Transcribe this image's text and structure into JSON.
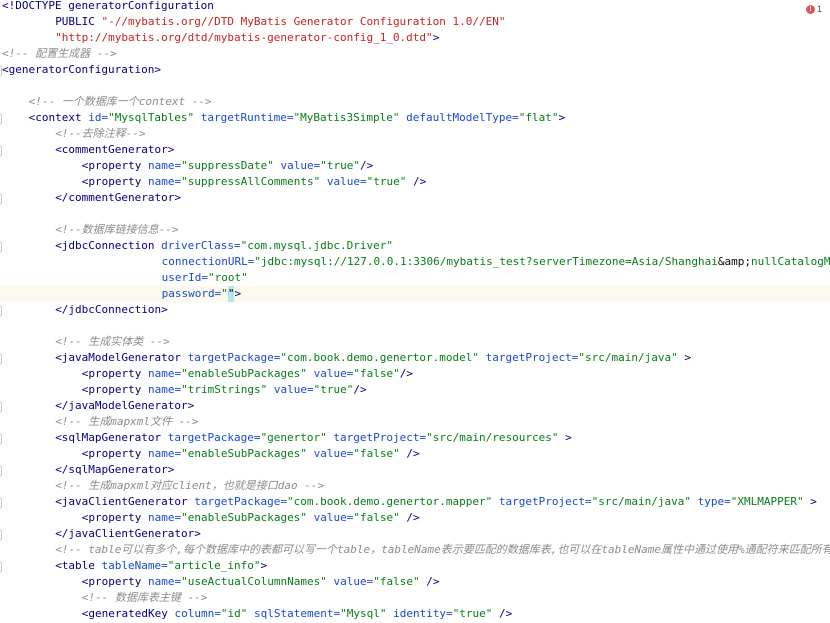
{
  "status": {
    "problems_count": "1",
    "problems_icon": "error-icon"
  },
  "current_line": 18,
  "lines": [
    {
      "indent": 0,
      "mark": false,
      "tokens": [
        [
          "dtd",
          "<!DOCTYPE generatorConfiguration"
        ]
      ]
    },
    {
      "indent": 4,
      "mark": false,
      "tokens": [
        [
          "dtd",
          "PUBLIC "
        ],
        [
          "str",
          "\"-//mybatis.org//DTD MyBatis Generator Configuration 1.0//EN\""
        ]
      ]
    },
    {
      "indent": 4,
      "mark": false,
      "tokens": [
        [
          "str",
          "\"http://mybatis.org/dtd/mybatis-generator-config_1_0.dtd\""
        ],
        [
          "dtd",
          ">"
        ]
      ]
    },
    {
      "indent": 0,
      "mark": false,
      "tokens": [
        [
          "cmt",
          "<!-- 配置生成器 -->"
        ]
      ]
    },
    {
      "indent": 0,
      "mark": true,
      "tokens": [
        [
          "tag",
          "<generatorConfiguration>"
        ]
      ]
    },
    {
      "indent": 0,
      "mark": false,
      "tokens": []
    },
    {
      "indent": 2,
      "mark": false,
      "tokens": [
        [
          "cmt",
          "<!-- 一个数据库一个context -->"
        ]
      ]
    },
    {
      "indent": 2,
      "mark": true,
      "tokens": [
        [
          "tag",
          "<context "
        ],
        [
          "attr",
          "id="
        ],
        [
          "val",
          "\"MysqlTables\" "
        ],
        [
          "attr",
          "targetRuntime="
        ],
        [
          "val",
          "\"MyBatis3Simple\" "
        ],
        [
          "attr",
          "defaultModelType="
        ],
        [
          "val",
          "\"flat\""
        ],
        [
          "tag",
          ">"
        ]
      ]
    },
    {
      "indent": 4,
      "mark": false,
      "tokens": [
        [
          "cmt",
          "<!--去除注释-->"
        ]
      ]
    },
    {
      "indent": 4,
      "mark": true,
      "tokens": [
        [
          "tag",
          "<commentGenerator>"
        ]
      ]
    },
    {
      "indent": 6,
      "mark": false,
      "tokens": [
        [
          "tag",
          "<property "
        ],
        [
          "attr",
          "name="
        ],
        [
          "val",
          "\"suppressDate\" "
        ],
        [
          "attr",
          "value="
        ],
        [
          "val",
          "\"true\""
        ],
        [
          "tag",
          "/>"
        ]
      ]
    },
    {
      "indent": 6,
      "mark": false,
      "tokens": [
        [
          "tag",
          "<property "
        ],
        [
          "attr",
          "name="
        ],
        [
          "val",
          "\"suppressAllComments\" "
        ],
        [
          "attr",
          "value="
        ],
        [
          "val",
          "\"true\" "
        ],
        [
          "tag",
          "/>"
        ]
      ]
    },
    {
      "indent": 4,
      "mark": true,
      "tokens": [
        [
          "tag",
          "</commentGenerator>"
        ]
      ]
    },
    {
      "indent": 0,
      "mark": false,
      "tokens": []
    },
    {
      "indent": 4,
      "mark": false,
      "tokens": [
        [
          "cmt",
          "<!--数据库链接信息-->"
        ]
      ]
    },
    {
      "indent": 4,
      "mark": true,
      "tokens": [
        [
          "tag",
          "<jdbcConnection "
        ],
        [
          "attr",
          "driverClass="
        ],
        [
          "val",
          "\"com.mysql.jdbc.Driver\""
        ]
      ]
    },
    {
      "indent": 12,
      "mark": false,
      "tokens": [
        [
          "attr",
          "connectionURL="
        ],
        [
          "val",
          "\"jdbc:mysql://127.0.0.1:3306/mybatis_test?serverTimezone=Asia/Shanghai"
        ],
        [
          "plain",
          "&amp;"
        ],
        [
          "val",
          "nullCatalogMeansCurrent=true\""
        ]
      ]
    },
    {
      "indent": 12,
      "mark": false,
      "tokens": [
        [
          "attr",
          "userId="
        ],
        [
          "val",
          "\"root\""
        ]
      ]
    },
    {
      "indent": 12,
      "mark": false,
      "tokens": [
        [
          "attr",
          "password="
        ],
        [
          "val",
          "\""
        ],
        [
          "caret",
          "\""
        ],
        [
          "tag",
          ">"
        ]
      ]
    },
    {
      "indent": 4,
      "mark": true,
      "tokens": [
        [
          "tag",
          "</jdbcConnection>"
        ]
      ]
    },
    {
      "indent": 0,
      "mark": false,
      "tokens": []
    },
    {
      "indent": 4,
      "mark": false,
      "tokens": [
        [
          "cmt",
          "<!-- 生成实体类 -->"
        ]
      ]
    },
    {
      "indent": 4,
      "mark": true,
      "tokens": [
        [
          "tag",
          "<javaModelGenerator "
        ],
        [
          "attr",
          "targetPackage="
        ],
        [
          "val",
          "\"com.book.demo.genertor.model\" "
        ],
        [
          "attr",
          "targetProject="
        ],
        [
          "val",
          "\"src/main/java\" "
        ],
        [
          "tag",
          ">"
        ]
      ]
    },
    {
      "indent": 6,
      "mark": false,
      "tokens": [
        [
          "tag",
          "<property "
        ],
        [
          "attr",
          "name="
        ],
        [
          "val",
          "\"enableSubPackages\" "
        ],
        [
          "attr",
          "value="
        ],
        [
          "val",
          "\"false\""
        ],
        [
          "tag",
          "/>"
        ]
      ]
    },
    {
      "indent": 6,
      "mark": false,
      "tokens": [
        [
          "tag",
          "<property "
        ],
        [
          "attr",
          "name="
        ],
        [
          "val",
          "\"trimStrings\" "
        ],
        [
          "attr",
          "value="
        ],
        [
          "val",
          "\"true\""
        ],
        [
          "tag",
          "/>"
        ]
      ]
    },
    {
      "indent": 4,
      "mark": true,
      "tokens": [
        [
          "tag",
          "</javaModelGenerator>"
        ]
      ]
    },
    {
      "indent": 4,
      "mark": false,
      "tokens": [
        [
          "cmt",
          "<!-- 生成mapxml文件 -->"
        ]
      ]
    },
    {
      "indent": 4,
      "mark": true,
      "tokens": [
        [
          "tag",
          "<sqlMapGenerator "
        ],
        [
          "attr",
          "targetPackage="
        ],
        [
          "val",
          "\"genertor\" "
        ],
        [
          "attr",
          "targetProject="
        ],
        [
          "val",
          "\"src/main/resources\" "
        ],
        [
          "tag",
          ">"
        ]
      ]
    },
    {
      "indent": 6,
      "mark": false,
      "tokens": [
        [
          "tag",
          "<property "
        ],
        [
          "attr",
          "name="
        ],
        [
          "val",
          "\"enableSubPackages\" "
        ],
        [
          "attr",
          "value="
        ],
        [
          "val",
          "\"false\" "
        ],
        [
          "tag",
          "/>"
        ]
      ]
    },
    {
      "indent": 4,
      "mark": true,
      "tokens": [
        [
          "tag",
          "</sqlMapGenerator>"
        ]
      ]
    },
    {
      "indent": 4,
      "mark": false,
      "tokens": [
        [
          "cmt",
          "<!-- 生成mapxml对应client，也就是接口dao -->"
        ]
      ]
    },
    {
      "indent": 4,
      "mark": true,
      "tokens": [
        [
          "tag",
          "<javaClientGenerator "
        ],
        [
          "attr",
          "targetPackage="
        ],
        [
          "val",
          "\"com.book.demo.genertor.mapper\" "
        ],
        [
          "attr",
          "targetProject="
        ],
        [
          "val",
          "\"src/main/java\" "
        ],
        [
          "attr",
          "type="
        ],
        [
          "val",
          "\"XMLMAPPER\" "
        ],
        [
          "tag",
          ">"
        ]
      ]
    },
    {
      "indent": 6,
      "mark": false,
      "tokens": [
        [
          "tag",
          "<property "
        ],
        [
          "attr",
          "name="
        ],
        [
          "val",
          "\"enableSubPackages\" "
        ],
        [
          "attr",
          "value="
        ],
        [
          "val",
          "\"false\" "
        ],
        [
          "tag",
          "/>"
        ]
      ]
    },
    {
      "indent": 4,
      "mark": true,
      "tokens": [
        [
          "tag",
          "</javaClientGenerator>"
        ]
      ]
    },
    {
      "indent": 4,
      "mark": false,
      "tokens": [
        [
          "cmt",
          "<!-- table可以有多个,每个数据库中的表都可以写一个table，tableName表示要匹配的数据库表,也可以在tableName属性中通过使用%通配符来匹配所有数据库表,只有匹配的表才会自动生成文件 -->"
        ]
      ]
    },
    {
      "indent": 4,
      "mark": true,
      "tokens": [
        [
          "tag",
          "<table "
        ],
        [
          "attr",
          "tableName="
        ],
        [
          "val",
          "\"article_info\""
        ],
        [
          "tag",
          ">"
        ]
      ]
    },
    {
      "indent": 6,
      "mark": false,
      "tokens": [
        [
          "tag",
          "<property "
        ],
        [
          "attr",
          "name="
        ],
        [
          "val",
          "\"useActualColumnNames\" "
        ],
        [
          "attr",
          "value="
        ],
        [
          "val",
          "\"false\" "
        ],
        [
          "tag",
          "/>"
        ]
      ]
    },
    {
      "indent": 6,
      "mark": false,
      "tokens": [
        [
          "cmt",
          "<!-- 数据库表主键 -->"
        ]
      ]
    },
    {
      "indent": 6,
      "mark": false,
      "tokens": [
        [
          "tag",
          "<generatedKey "
        ],
        [
          "attr",
          "column="
        ],
        [
          "val",
          "\"id\" "
        ],
        [
          "attr",
          "sqlStatement="
        ],
        [
          "val",
          "\"Mysql\" "
        ],
        [
          "attr",
          "identity="
        ],
        [
          "val",
          "\"true\" "
        ],
        [
          "tag",
          "/>"
        ]
      ]
    }
  ]
}
